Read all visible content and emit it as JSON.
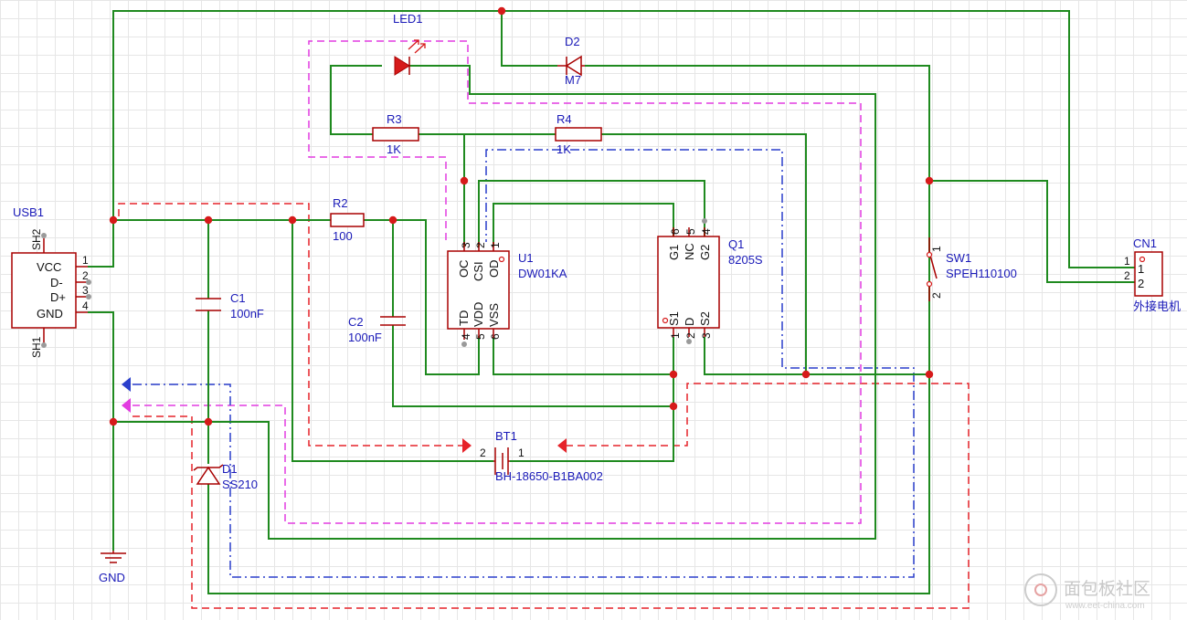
{
  "components": {
    "usb1": {
      "ref": "USB1",
      "sh2": "SH2",
      "sh1": "SH1",
      "pins": [
        "VCC",
        "D-",
        "D+",
        "GND"
      ],
      "nums": [
        "1",
        "2",
        "3",
        "4"
      ]
    },
    "gnd": {
      "label": "GND"
    },
    "c1": {
      "ref": "C1",
      "value": "100nF"
    },
    "c2": {
      "ref": "C2",
      "value": "100nF"
    },
    "r2": {
      "ref": "R2",
      "value": "100"
    },
    "r3": {
      "ref": "R3",
      "value": "1K"
    },
    "r4": {
      "ref": "R4",
      "value": "1K"
    },
    "led1": {
      "ref": "LED1"
    },
    "d2": {
      "ref": "D2",
      "value": "M7"
    },
    "d1": {
      "ref": "D1",
      "value": "SS210"
    },
    "u1": {
      "ref": "U1",
      "value": "DW01KA",
      "top_pins": [
        "OC",
        "CSI",
        "OD"
      ],
      "top_nums": [
        "3",
        "2",
        "1"
      ],
      "bottom_pins": [
        "TD",
        "VDD",
        "VSS"
      ],
      "bottom_nums": [
        "4",
        "5",
        "6"
      ]
    },
    "q1": {
      "ref": "Q1",
      "value": "8205S",
      "top_pins": [
        "G1",
        "NC",
        "G2"
      ],
      "top_nums": [
        "6",
        "5",
        "4"
      ],
      "bottom_pins": [
        "S1",
        "D",
        "S2"
      ],
      "bottom_nums": [
        "1",
        "2",
        "3"
      ]
    },
    "sw1": {
      "ref": "SW1",
      "value": "SPEH110100",
      "nums": [
        "1",
        "2"
      ]
    },
    "cn1": {
      "ref": "CN1",
      "value": "外接电机",
      "nums": [
        "1",
        "2"
      ]
    },
    "bt1": {
      "ref": "BT1",
      "value": "BH-18650-B1BA002",
      "nums": [
        "2",
        "1"
      ]
    }
  },
  "watermark": {
    "text": "面包板社区",
    "url": "www.eet-china.com"
  },
  "colors": {
    "wire": "#1f8a1f",
    "component": "#a80000",
    "label": "#1a1ab8",
    "junction": "#d61a1a",
    "group_red": "#e6232a",
    "group_magenta": "#e23be0",
    "group_blue": "#2a3fcc"
  }
}
